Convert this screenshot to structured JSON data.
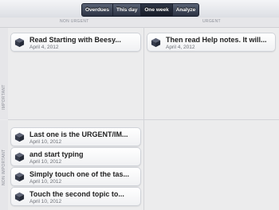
{
  "toolbar": {
    "segments": [
      {
        "label": "Overdues",
        "active": false
      },
      {
        "label": "This day",
        "active": false
      },
      {
        "label": "One week",
        "active": true
      },
      {
        "label": "Analyze",
        "active": false
      }
    ]
  },
  "headers": {
    "non_urgent": "NON URGENT",
    "urgent": "URGENT"
  },
  "side_labels": {
    "important": "IMPORTANT",
    "non_important": "NON IMPORTANT"
  },
  "quadrants": {
    "important_non_urgent": [
      {
        "title": "Read Starting with Beesy...",
        "date": "April 4, 2012",
        "icon": "cube-icon"
      }
    ],
    "important_urgent": [
      {
        "title": "Then read Help notes. It will...",
        "date": "April 4, 2012",
        "icon": "cube-icon"
      }
    ],
    "non_important_non_urgent": [
      {
        "title": "Last one is the URGENT/IM...",
        "date": "April 10, 2012",
        "icon": "cube-icon"
      },
      {
        "title": "and start typing",
        "date": "April 10, 2012",
        "icon": "cube-icon"
      },
      {
        "title": "Simply touch one of the tas...",
        "date": "April 10, 2012",
        "icon": "cube-icon"
      },
      {
        "title": "Touch the second topic to...",
        "date": "April 10, 2012",
        "icon": "cube-icon"
      }
    ]
  },
  "colors": {
    "accent_dark": "#2b3242",
    "background": "#ececed",
    "cube_top": "#5d6375"
  }
}
